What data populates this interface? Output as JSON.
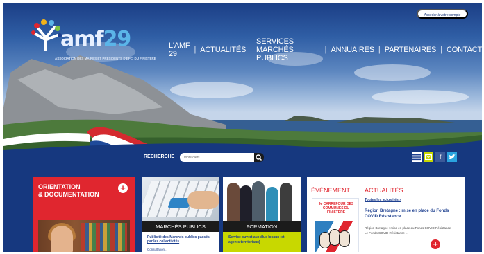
{
  "header": {
    "account_button": "Accéder à votre compte",
    "logo": {
      "name": "amf",
      "number": "29",
      "subtitle": "ASSOCIATION DES MAIRES ET PRÉSIDENTS D'EPCI DU FINISTÈRE"
    },
    "nav": [
      "L'AMF 29",
      "ACTUALITÉS",
      "SERVICES MARCHÉS PUBLICS",
      "ANNUAIRES",
      "PARTENAIRES",
      "CONTACT"
    ]
  },
  "search": {
    "label": "RECHERCHE",
    "placeholder": "mots clefs"
  },
  "social": [
    "list-icon",
    "mail-icon",
    "facebook-icon",
    "twitter-icon"
  ],
  "tiles": {
    "orientation": {
      "title_line1": "ORIENTATION",
      "title_line2": "& DOCUMENTATION"
    },
    "marches": {
      "band": "MARCHÉS PUBLICS",
      "desc": "Publicité des Marchés publics passés par les collectivités",
      "sub": "Consultation..."
    },
    "formation": {
      "band": "FORMATION",
      "desc": "Service ouvert aux élus locaux (et agents territoriaux)"
    }
  },
  "panel": {
    "event_title": "ÉVÉNEMENT",
    "poster_text": "9e CARREFOUR DES COMMUNES DU FINISTÈRE",
    "news_title": "ACTUALITÉS",
    "all_news": "Toutes les actualités »",
    "news_headline": "Région Bretagne : mise en place du Fonds COVID Résistance",
    "news_body": "Région Bretagne : mise en place du Fonds COVID Résistance  Le Fonds COVID Résistance ..."
  },
  "colors": {
    "brand_blue": "#16387f",
    "accent_red": "#e0262f",
    "accent_green": "#c8d800"
  }
}
